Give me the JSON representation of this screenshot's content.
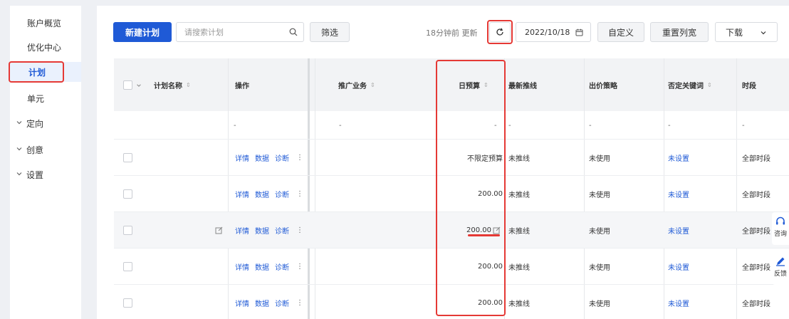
{
  "sidebar": {
    "items": [
      {
        "label": "账户概览"
      },
      {
        "label": "优化中心"
      },
      {
        "label": "计划"
      },
      {
        "label": "单元"
      },
      {
        "label": "定向"
      },
      {
        "label": "创意"
      },
      {
        "label": "设置"
      }
    ]
  },
  "toolbar": {
    "new_plan": "新建计划",
    "search_placeholder": "请搜索计划",
    "filter": "筛选",
    "update_text": "18分钟前 更新",
    "date": "2022/10/18",
    "customize": "自定义",
    "reset_width": "重置列宽",
    "download": "下载"
  },
  "table": {
    "headers": {
      "name": "计划名称",
      "ops": "操作",
      "business": "推广业务",
      "budget": "日预算",
      "latest_status": "最新推线",
      "bid_strategy": "出价策略",
      "negative_keywords": "否定关键词",
      "time_slot": "时段"
    },
    "summary": {
      "name": "-",
      "business": "-",
      "budget": "-",
      "latest_status": "-",
      "bid_strategy": "-",
      "negative_keywords": "-",
      "time_slot": "-"
    },
    "op_labels": {
      "detail": "详情",
      "data": "数据",
      "diagnose": "诊断",
      "more": "⋮"
    },
    "rows": [
      {
        "budget": "不限定预算",
        "latest_status": "未推线",
        "bid_strategy": "未使用",
        "negative_keywords": "未设置",
        "time_slot": "全部时段"
      },
      {
        "budget": "200.00",
        "latest_status": "未推线",
        "bid_strategy": "未使用",
        "negative_keywords": "未设置",
        "time_slot": "全部时段"
      },
      {
        "budget": "200.00",
        "latest_status": "未推线",
        "bid_strategy": "未使用",
        "negative_keywords": "未设置",
        "time_slot": "全部时段"
      },
      {
        "budget": "200.00",
        "latest_status": "未推线",
        "bid_strategy": "未使用",
        "negative_keywords": "未设置",
        "time_slot": "全部时段"
      },
      {
        "budget": "200.00",
        "latest_status": "未推线",
        "bid_strategy": "未使用",
        "negative_keywords": "未设置",
        "time_slot": "全部时段"
      }
    ]
  },
  "float_tools": {
    "consult": "咨询",
    "feedback": "反馈"
  },
  "colors": {
    "accent": "#1f5ad6",
    "highlight": "#e53935",
    "header_bg": "#f2f3f5"
  }
}
